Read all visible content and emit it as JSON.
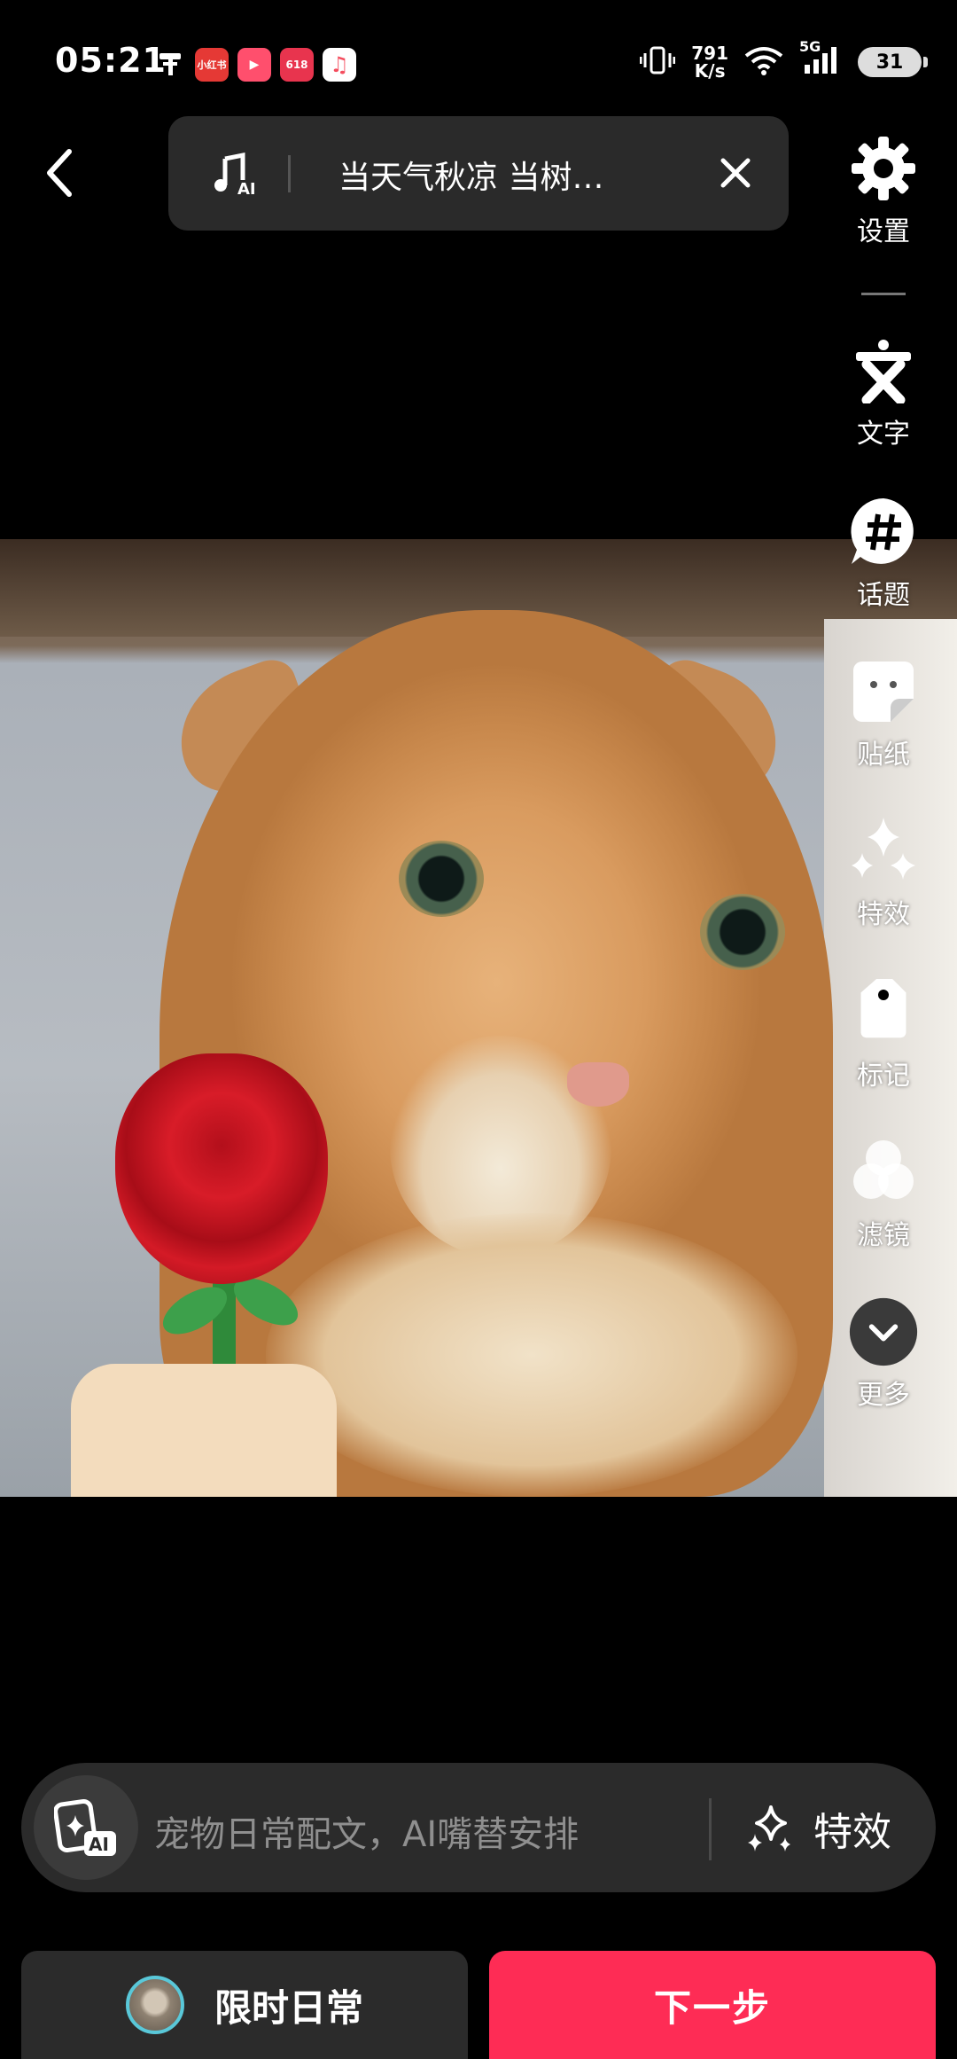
{
  "status_bar": {
    "time": "05:21",
    "net_speed_value": "791",
    "net_speed_unit": "K/s",
    "network_type": "5G",
    "battery": "31",
    "apps": [
      {
        "name": "xiaohongshu-app-icon",
        "label": "小红书",
        "color": "#e53935"
      },
      {
        "name": "video-app-icon",
        "label": "▶",
        "color": "#ff4f6d"
      },
      {
        "name": "shopping-618-app-icon",
        "label": "618",
        "color": "#e8344e"
      },
      {
        "name": "music-app-icon",
        "label": "♫",
        "color": "#f44d5e"
      }
    ]
  },
  "top_bar": {
    "music_title": "当天气秋凉 当树…",
    "music_icon": "music-ai-icon",
    "close_icon": "close-icon",
    "back_icon": "back-chevron-icon"
  },
  "toolbar": {
    "settings": "设置",
    "text": "文字",
    "topic": "话题",
    "sticker": "贴纸",
    "effects": "特效",
    "mark": "标记",
    "filter": "滤镜",
    "more": "更多"
  },
  "ai_bar": {
    "placeholder": "宠物日常配文，AI嘴替安排",
    "effects_label": "特效"
  },
  "bottom": {
    "daily_label": "限时日常",
    "next_label": "下一步"
  },
  "colors": {
    "accent": "#fe2c55",
    "panel": "#2b2b2b",
    "background": "#000000"
  }
}
